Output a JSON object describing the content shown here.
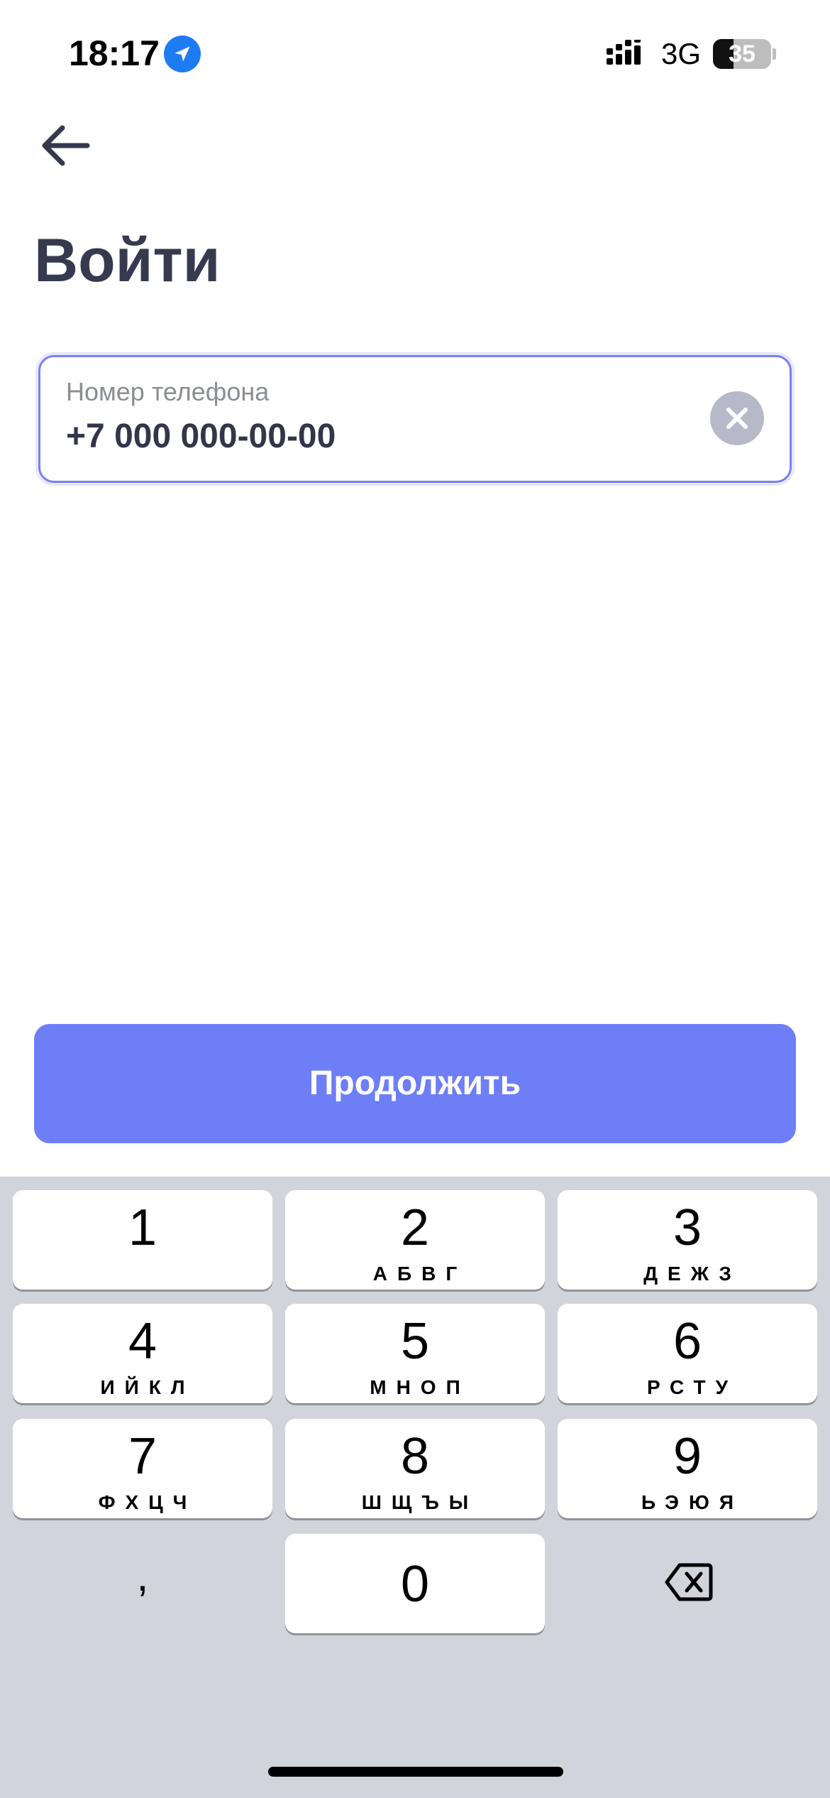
{
  "status_bar": {
    "time": "18:17",
    "network": "3G",
    "battery_level": "35",
    "battery_fraction": 0.35,
    "icons": [
      "location-arrow-icon",
      "signal-bars-icon",
      "battery-icon"
    ],
    "location_color": "#1e7cf2"
  },
  "header": {
    "back_icon": "arrow-left-icon",
    "title": "Войти"
  },
  "phone_field": {
    "label": "Номер телефона",
    "value": "+7 000 000-00-00",
    "clear_icon": "close-circle-icon",
    "border_color": "#7a80f0"
  },
  "continue_button": {
    "label": "Продолжить",
    "color": "#6e7ef7"
  },
  "keypad": {
    "keys": [
      {
        "digit": "1",
        "letters": ""
      },
      {
        "digit": "2",
        "letters": "АБВГ"
      },
      {
        "digit": "3",
        "letters": "ДЕЖЗ"
      },
      {
        "digit": "4",
        "letters": "ИЙКЛ"
      },
      {
        "digit": "5",
        "letters": "МНОП"
      },
      {
        "digit": "6",
        "letters": "РСТУ"
      },
      {
        "digit": "7",
        "letters": "ФХЦЧ"
      },
      {
        "digit": "8",
        "letters": "ШЩЪЫ"
      },
      {
        "digit": "9",
        "letters": "ЬЭЮЯ"
      }
    ],
    "zero": "0",
    "comma": ",",
    "delete_icon": "backspace-icon",
    "background": "#d1d4da"
  }
}
